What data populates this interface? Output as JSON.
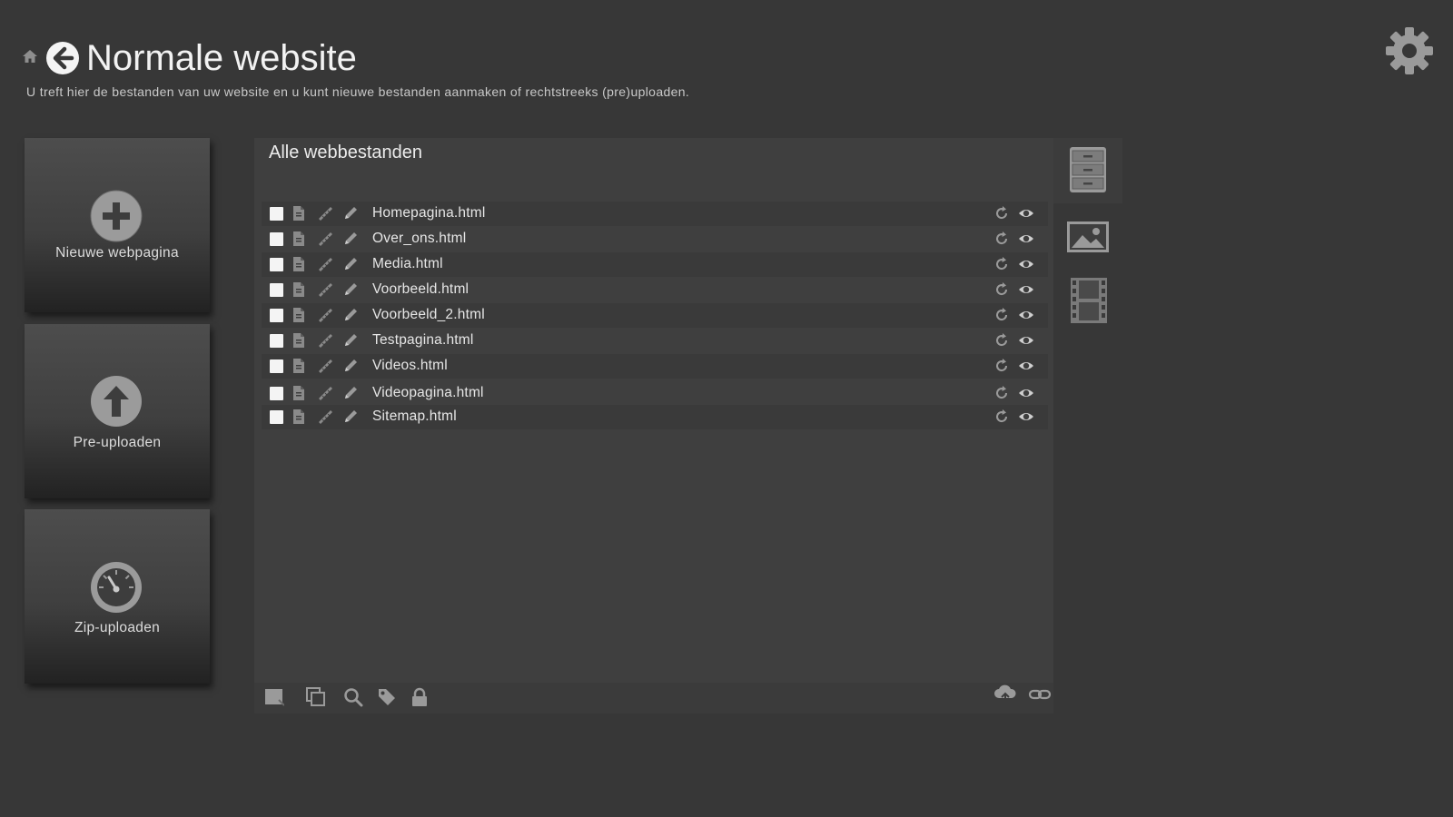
{
  "header": {
    "title": "Normale website",
    "subtitle": "U treft hier de bestanden van uw website en u kunt nieuwe bestanden aanmaken of rechtstreeks (pre)uploaden."
  },
  "tiles": [
    {
      "label": "Nieuwe webpagina",
      "icon": "plus-circle-icon"
    },
    {
      "label": "Pre-uploaden",
      "icon": "upload-arrow-icon"
    },
    {
      "label": "Zip-uploaden",
      "icon": "speedometer-icon"
    }
  ],
  "panel": {
    "title": "Alle webbestanden",
    "files": [
      {
        "name": "Homepagina.html"
      },
      {
        "name": "Over_ons.html"
      },
      {
        "name": "Media.html"
      },
      {
        "name": "Voorbeeld.html"
      },
      {
        "name": "Voorbeeld_2.html"
      },
      {
        "name": "Testpagina.html"
      },
      {
        "name": "Videos.html"
      },
      {
        "name": "Videopagina.html"
      },
      {
        "name": "Sitemap.html"
      }
    ]
  },
  "side_icons": [
    "file-cabinet-icon",
    "image-icon",
    "film-icon"
  ],
  "toolbar_icons": [
    "select-all-icon",
    "copy-icon",
    "search-icon",
    "tag-icon",
    "lock-icon",
    "cloud-upload-icon",
    "link-icon"
  ],
  "colors": {
    "background": "#373737",
    "panel": "#3f3f3f",
    "text": "#e6e6e6"
  }
}
